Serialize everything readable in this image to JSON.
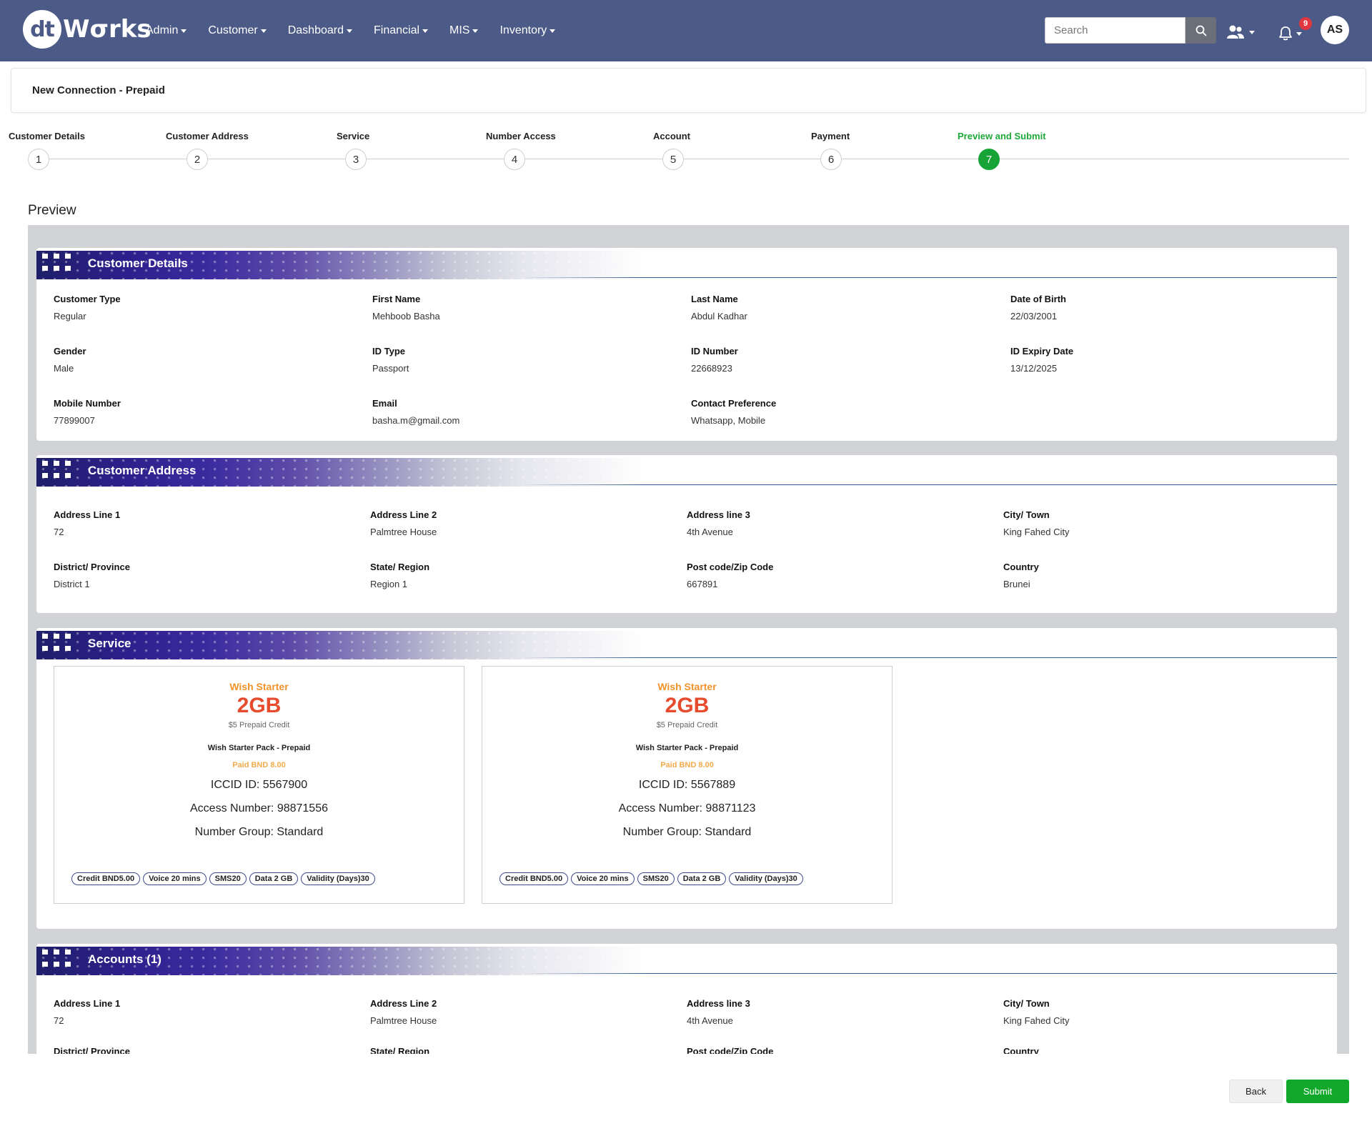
{
  "app": {
    "logo_mark": "dt",
    "logo_text": "Wσrks",
    "nav": [
      "Admin",
      "Customer",
      "Dashboard",
      "Financial",
      "MIS",
      "Inventory"
    ],
    "search_placeholder": "Search",
    "notification_count": "9",
    "user_initials": "AS"
  },
  "page": {
    "title": "New Connection - Prepaid",
    "preview_heading": "Preview"
  },
  "stepper": [
    {
      "label": "Customer Details",
      "number": "1"
    },
    {
      "label": "Customer Address",
      "number": "2"
    },
    {
      "label": "Service",
      "number": "3"
    },
    {
      "label": "Number Access",
      "number": "4"
    },
    {
      "label": "Account",
      "number": "5"
    },
    {
      "label": "Payment",
      "number": "6"
    },
    {
      "label": "Preview and Submit",
      "number": "7",
      "active": true
    }
  ],
  "customer_details": {
    "title": "Customer Details",
    "fields": [
      {
        "label": "Customer Type",
        "value": "Regular"
      },
      {
        "label": "First Name",
        "value": "Mehboob Basha"
      },
      {
        "label": "Last Name",
        "value": "Abdul Kadhar"
      },
      {
        "label": "Date of Birth",
        "value": "22/03/2001"
      },
      {
        "label": "Gender",
        "value": "Male"
      },
      {
        "label": "ID Type",
        "value": "Passport"
      },
      {
        "label": "ID Number",
        "value": "22668923"
      },
      {
        "label": "ID Expiry Date",
        "value": "13/12/2025"
      },
      {
        "label": "Mobile Number",
        "value": "77899007"
      },
      {
        "label": "Email",
        "value": "basha.m@gmail.com"
      },
      {
        "label": "Contact Preference",
        "value": "Whatsapp, Mobile"
      }
    ]
  },
  "customer_address": {
    "title": "Customer Address",
    "fields": [
      {
        "label": "Address Line 1",
        "value": "72"
      },
      {
        "label": "Address Line 2",
        "value": "Palmtree House"
      },
      {
        "label": "Address line 3",
        "value": "4th Avenue"
      },
      {
        "label": "City/ Town",
        "value": "King Fahed City"
      },
      {
        "label": "District/ Province",
        "value": "District 1"
      },
      {
        "label": "State/ Region",
        "value": "Region 1"
      },
      {
        "label": "Post code/Zip Code",
        "value": "667891"
      },
      {
        "label": "Country",
        "value": "Brunei"
      }
    ]
  },
  "service": {
    "title": "Service",
    "cards": [
      {
        "plan": "Wish Starter",
        "data": "2GB",
        "credit": "$5 Prepaid Credit",
        "pack": "Wish Starter Pack - Prepaid",
        "paid": "Paid BND 8.00",
        "iccid": "ICCID ID: 5567900",
        "access": "Access Number: 98871556",
        "group": "Number Group: Standard",
        "tags": [
          "Credit BND5.00",
          "Voice 20 mins",
          "SMS20",
          "Data 2 GB",
          "Validity (Days)30"
        ]
      },
      {
        "plan": "Wish Starter",
        "data": "2GB",
        "credit": "$5 Prepaid Credit",
        "pack": "Wish Starter Pack - Prepaid",
        "paid": "Paid BND 8.00",
        "iccid": "ICCID ID: 5567889",
        "access": "Access Number: 98871123",
        "group": "Number Group: Standard",
        "tags": [
          "Credit BND5.00",
          "Voice 20 mins",
          "SMS20",
          "Data 2 GB",
          "Validity (Days)30"
        ]
      }
    ]
  },
  "accounts": {
    "title": "Accounts (1)",
    "fields": [
      {
        "label": "Address Line 1",
        "value": "72"
      },
      {
        "label": "Address Line 2",
        "value": "Palmtree House"
      },
      {
        "label": "Address line 3",
        "value": "4th Avenue"
      },
      {
        "label": "City/ Town",
        "value": "King Fahed City"
      },
      {
        "label": "District/ Province",
        "value": ""
      },
      {
        "label": "State/ Region",
        "value": ""
      },
      {
        "label": "Post code/Zip Code",
        "value": ""
      },
      {
        "label": "Country",
        "value": ""
      }
    ]
  },
  "buttons": {
    "back": "Back",
    "submit": "Submit"
  },
  "colors": {
    "navbar": "#4b5a86",
    "active_step": "#17a336",
    "submit": "#12a82c",
    "plan_orange": "#f0932b",
    "data_red": "#e64b2e"
  }
}
